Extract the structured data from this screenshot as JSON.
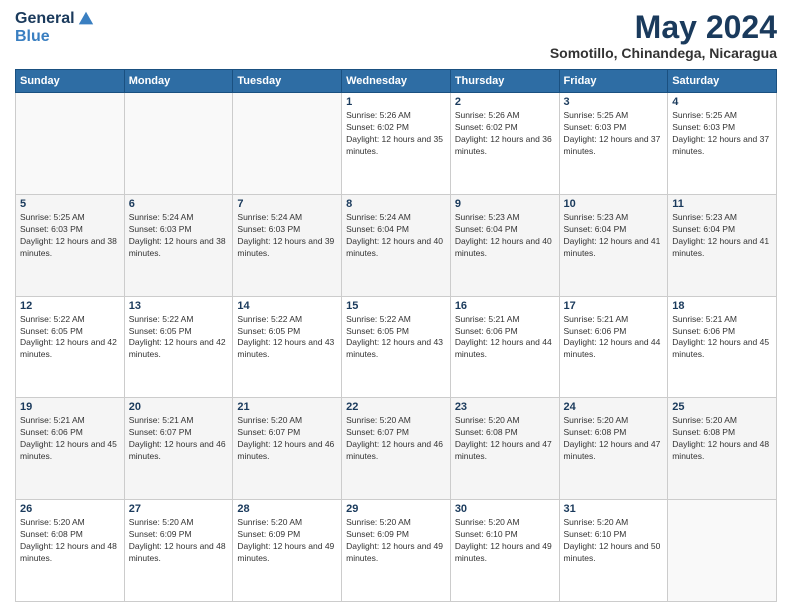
{
  "logo": {
    "general": "General",
    "blue": "Blue"
  },
  "title": "May 2024",
  "location": "Somotillo, Chinandega, Nicaragua",
  "headers": [
    "Sunday",
    "Monday",
    "Tuesday",
    "Wednesday",
    "Thursday",
    "Friday",
    "Saturday"
  ],
  "weeks": [
    [
      {
        "day": "",
        "sunrise": "",
        "sunset": "",
        "daylight": ""
      },
      {
        "day": "",
        "sunrise": "",
        "sunset": "",
        "daylight": ""
      },
      {
        "day": "",
        "sunrise": "",
        "sunset": "",
        "daylight": ""
      },
      {
        "day": "1",
        "sunrise": "Sunrise: 5:26 AM",
        "sunset": "Sunset: 6:02 PM",
        "daylight": "Daylight: 12 hours and 35 minutes."
      },
      {
        "day": "2",
        "sunrise": "Sunrise: 5:26 AM",
        "sunset": "Sunset: 6:02 PM",
        "daylight": "Daylight: 12 hours and 36 minutes."
      },
      {
        "day": "3",
        "sunrise": "Sunrise: 5:25 AM",
        "sunset": "Sunset: 6:03 PM",
        "daylight": "Daylight: 12 hours and 37 minutes."
      },
      {
        "day": "4",
        "sunrise": "Sunrise: 5:25 AM",
        "sunset": "Sunset: 6:03 PM",
        "daylight": "Daylight: 12 hours and 37 minutes."
      }
    ],
    [
      {
        "day": "5",
        "sunrise": "Sunrise: 5:25 AM",
        "sunset": "Sunset: 6:03 PM",
        "daylight": "Daylight: 12 hours and 38 minutes."
      },
      {
        "day": "6",
        "sunrise": "Sunrise: 5:24 AM",
        "sunset": "Sunset: 6:03 PM",
        "daylight": "Daylight: 12 hours and 38 minutes."
      },
      {
        "day": "7",
        "sunrise": "Sunrise: 5:24 AM",
        "sunset": "Sunset: 6:03 PM",
        "daylight": "Daylight: 12 hours and 39 minutes."
      },
      {
        "day": "8",
        "sunrise": "Sunrise: 5:24 AM",
        "sunset": "Sunset: 6:04 PM",
        "daylight": "Daylight: 12 hours and 40 minutes."
      },
      {
        "day": "9",
        "sunrise": "Sunrise: 5:23 AM",
        "sunset": "Sunset: 6:04 PM",
        "daylight": "Daylight: 12 hours and 40 minutes."
      },
      {
        "day": "10",
        "sunrise": "Sunrise: 5:23 AM",
        "sunset": "Sunset: 6:04 PM",
        "daylight": "Daylight: 12 hours and 41 minutes."
      },
      {
        "day": "11",
        "sunrise": "Sunrise: 5:23 AM",
        "sunset": "Sunset: 6:04 PM",
        "daylight": "Daylight: 12 hours and 41 minutes."
      }
    ],
    [
      {
        "day": "12",
        "sunrise": "Sunrise: 5:22 AM",
        "sunset": "Sunset: 6:05 PM",
        "daylight": "Daylight: 12 hours and 42 minutes."
      },
      {
        "day": "13",
        "sunrise": "Sunrise: 5:22 AM",
        "sunset": "Sunset: 6:05 PM",
        "daylight": "Daylight: 12 hours and 42 minutes."
      },
      {
        "day": "14",
        "sunrise": "Sunrise: 5:22 AM",
        "sunset": "Sunset: 6:05 PM",
        "daylight": "Daylight: 12 hours and 43 minutes."
      },
      {
        "day": "15",
        "sunrise": "Sunrise: 5:22 AM",
        "sunset": "Sunset: 6:05 PM",
        "daylight": "Daylight: 12 hours and 43 minutes."
      },
      {
        "day": "16",
        "sunrise": "Sunrise: 5:21 AM",
        "sunset": "Sunset: 6:06 PM",
        "daylight": "Daylight: 12 hours and 44 minutes."
      },
      {
        "day": "17",
        "sunrise": "Sunrise: 5:21 AM",
        "sunset": "Sunset: 6:06 PM",
        "daylight": "Daylight: 12 hours and 44 minutes."
      },
      {
        "day": "18",
        "sunrise": "Sunrise: 5:21 AM",
        "sunset": "Sunset: 6:06 PM",
        "daylight": "Daylight: 12 hours and 45 minutes."
      }
    ],
    [
      {
        "day": "19",
        "sunrise": "Sunrise: 5:21 AM",
        "sunset": "Sunset: 6:06 PM",
        "daylight": "Daylight: 12 hours and 45 minutes."
      },
      {
        "day": "20",
        "sunrise": "Sunrise: 5:21 AM",
        "sunset": "Sunset: 6:07 PM",
        "daylight": "Daylight: 12 hours and 46 minutes."
      },
      {
        "day": "21",
        "sunrise": "Sunrise: 5:20 AM",
        "sunset": "Sunset: 6:07 PM",
        "daylight": "Daylight: 12 hours and 46 minutes."
      },
      {
        "day": "22",
        "sunrise": "Sunrise: 5:20 AM",
        "sunset": "Sunset: 6:07 PM",
        "daylight": "Daylight: 12 hours and 46 minutes."
      },
      {
        "day": "23",
        "sunrise": "Sunrise: 5:20 AM",
        "sunset": "Sunset: 6:08 PM",
        "daylight": "Daylight: 12 hours and 47 minutes."
      },
      {
        "day": "24",
        "sunrise": "Sunrise: 5:20 AM",
        "sunset": "Sunset: 6:08 PM",
        "daylight": "Daylight: 12 hours and 47 minutes."
      },
      {
        "day": "25",
        "sunrise": "Sunrise: 5:20 AM",
        "sunset": "Sunset: 6:08 PM",
        "daylight": "Daylight: 12 hours and 48 minutes."
      }
    ],
    [
      {
        "day": "26",
        "sunrise": "Sunrise: 5:20 AM",
        "sunset": "Sunset: 6:08 PM",
        "daylight": "Daylight: 12 hours and 48 minutes."
      },
      {
        "day": "27",
        "sunrise": "Sunrise: 5:20 AM",
        "sunset": "Sunset: 6:09 PM",
        "daylight": "Daylight: 12 hours and 48 minutes."
      },
      {
        "day": "28",
        "sunrise": "Sunrise: 5:20 AM",
        "sunset": "Sunset: 6:09 PM",
        "daylight": "Daylight: 12 hours and 49 minutes."
      },
      {
        "day": "29",
        "sunrise": "Sunrise: 5:20 AM",
        "sunset": "Sunset: 6:09 PM",
        "daylight": "Daylight: 12 hours and 49 minutes."
      },
      {
        "day": "30",
        "sunrise": "Sunrise: 5:20 AM",
        "sunset": "Sunset: 6:10 PM",
        "daylight": "Daylight: 12 hours and 49 minutes."
      },
      {
        "day": "31",
        "sunrise": "Sunrise: 5:20 AM",
        "sunset": "Sunset: 6:10 PM",
        "daylight": "Daylight: 12 hours and 50 minutes."
      },
      {
        "day": "",
        "sunrise": "",
        "sunset": "",
        "daylight": ""
      }
    ]
  ]
}
